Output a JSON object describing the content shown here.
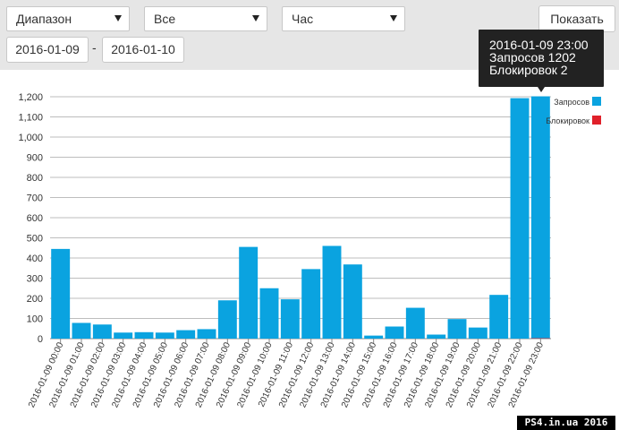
{
  "toolbar": {
    "range_select": "Диапазон",
    "filter_select": "Все",
    "period_select": "Час",
    "show_button": "Показать",
    "date_from": "2016-01-09",
    "date_separator": "-",
    "date_to": "2016-01-10"
  },
  "tooltip": {
    "time": "2016-01-09 23:00",
    "requests": "Запросов 1202",
    "blocks": "Блокировок 2"
  },
  "watermark": "PS4.in.ua  2016",
  "chart_data": {
    "type": "bar",
    "categories": [
      "2016-01-09 00:00",
      "2016-01-09 01:00",
      "2016-01-09 02:00",
      "2016-01-09 03:00",
      "2016-01-09 04:00",
      "2016-01-09 05:00",
      "2016-01-09 06:00",
      "2016-01-09 07:00",
      "2016-01-09 08:00",
      "2016-01-09 09:00",
      "2016-01-09 10:00",
      "2016-01-09 11:00",
      "2016-01-09 12:00",
      "2016-01-09 13:00",
      "2016-01-09 14:00",
      "2016-01-09 15:00",
      "2016-01-09 16:00",
      "2016-01-09 17:00",
      "2016-01-09 18:00",
      "2016-01-09 19:00",
      "2016-01-09 20:00",
      "2016-01-09 21:00",
      "2016-01-09 22:00",
      "2016-01-09 23:00"
    ],
    "series": [
      {
        "name": "Запросов",
        "color": "#0aa3e0",
        "values": [
          445,
          78,
          70,
          30,
          32,
          30,
          42,
          47,
          190,
          455,
          250,
          195,
          345,
          460,
          368,
          15,
          60,
          153,
          20,
          97,
          55,
          217,
          1193,
          1202
        ]
      },
      {
        "name": "Блокировок",
        "color": "#e0202a",
        "values": [
          0,
          0,
          0,
          0,
          0,
          0,
          0,
          0,
          0,
          0,
          0,
          0,
          0,
          0,
          0,
          0,
          0,
          0,
          0,
          0,
          0,
          0,
          0,
          2
        ]
      }
    ],
    "ylim": [
      0,
      1200
    ],
    "yticks": [
      0,
      100,
      200,
      300,
      400,
      500,
      600,
      700,
      800,
      900,
      1000,
      1100,
      1200
    ],
    "ytick_labels": [
      "0",
      "100",
      "200",
      "300",
      "400",
      "500",
      "600",
      "700",
      "800",
      "900",
      "1,000",
      "1,100",
      "1,200"
    ],
    "grid": true,
    "legend": "right"
  }
}
